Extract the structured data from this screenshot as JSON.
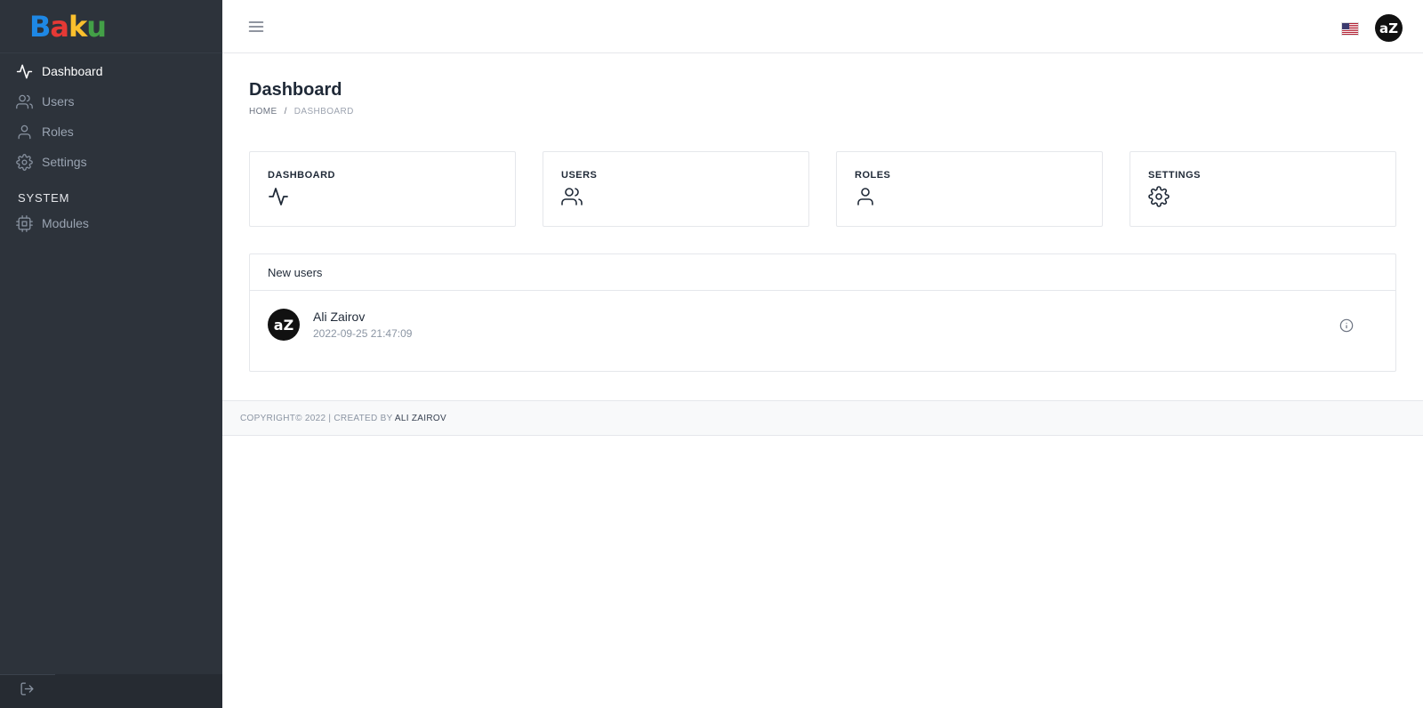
{
  "brand": {
    "letters": [
      {
        "char": "B",
        "color": "#1e88e5"
      },
      {
        "char": "a",
        "color": "#e53935"
      },
      {
        "char": "k",
        "color": "#fbc02d"
      },
      {
        "char": "u",
        "color": "#43a047"
      }
    ]
  },
  "sidebar": {
    "items": [
      {
        "label": "Dashboard",
        "icon": "activity-icon",
        "active": true
      },
      {
        "label": "Users",
        "icon": "users-icon",
        "active": false
      },
      {
        "label": "Roles",
        "icon": "user-icon",
        "active": false
      },
      {
        "label": "Settings",
        "icon": "gear-icon",
        "active": false
      }
    ],
    "section_label": "SYSTEM",
    "system_items": [
      {
        "label": "Modules",
        "icon": "cpu-icon"
      }
    ],
    "footer_icon": "logout-icon"
  },
  "header": {
    "menu_icon": "hamburger-icon",
    "language_flag": "us-flag-icon",
    "avatar_text": "aZ"
  },
  "main": {
    "title": "Dashboard",
    "breadcrumb": {
      "home": "HOME",
      "separator": "/",
      "current": "DASHBOARD"
    },
    "cards": [
      {
        "title": "DASHBOARD",
        "icon": "activity-icon"
      },
      {
        "title": "USERS",
        "icon": "users-icon"
      },
      {
        "title": "ROLES",
        "icon": "user-icon"
      },
      {
        "title": "SETTINGS",
        "icon": "gear-icon"
      }
    ],
    "new_users": {
      "title": "New users",
      "users": [
        {
          "avatar_text": "aZ",
          "name": "Ali Zairov",
          "date": "2022-09-25 21:47:09"
        }
      ]
    }
  },
  "footer": {
    "text": "COPYRIGHT© 2022 | CREATED BY",
    "author": "ALI ZAIROV"
  },
  "colors": {
    "sidebar_bg": "#2d333b",
    "sidebar_text": "#9aa4b2",
    "active_text": "#ffffff",
    "border": "#e5e7eb"
  }
}
